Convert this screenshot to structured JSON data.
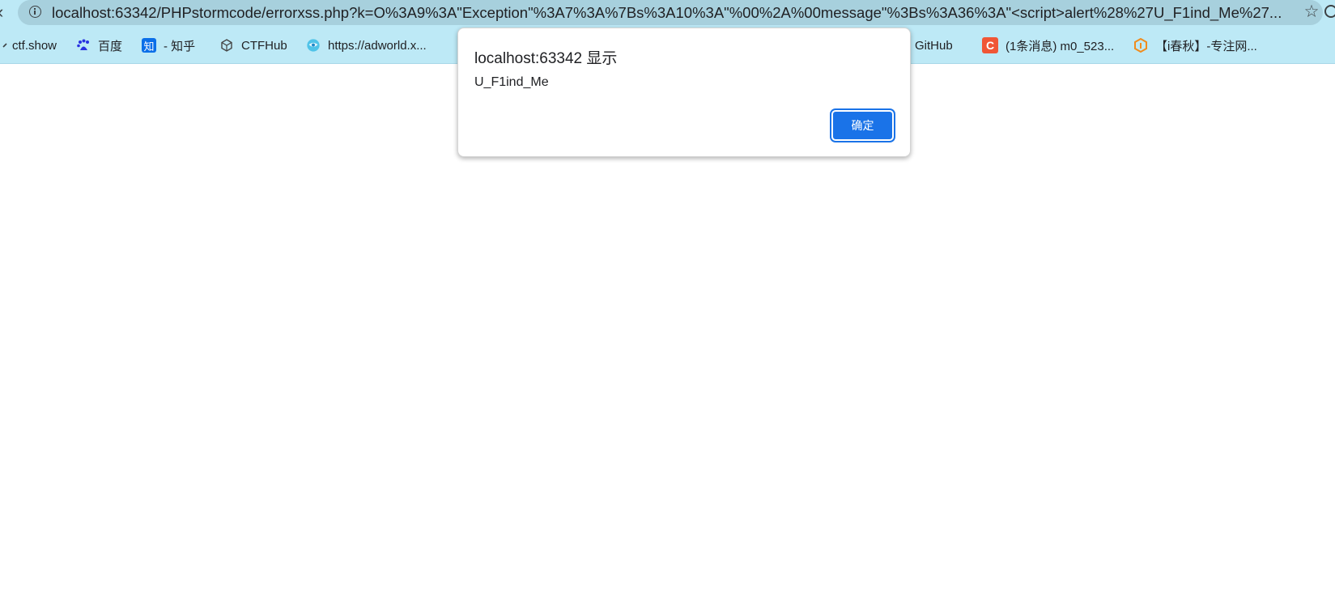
{
  "browser": {
    "url": "localhost:63342/PHPstormcode/errorxss.php?k=O%3A9%3A\"Exception\"%3A7%3A%7Bs%3A10%3A\"%00%2A%00message\"%3Bs%3A36%3A\"<script>alert%28%27U_F1ind_Me%27..."
  },
  "bookmarks": [
    {
      "label": "ctf.show",
      "icon": "arrow-icon"
    },
    {
      "label": "百度",
      "icon": "baidu-paw-icon"
    },
    {
      "label": "- 知乎",
      "icon": "zhihu-icon",
      "badge": "知"
    },
    {
      "label": "CTFHub",
      "icon": "ctfhub-cube-icon"
    },
    {
      "label": "https://adworld.x...",
      "icon": "adworld-globe-icon"
    },
    {
      "label": "GitHub",
      "icon": "github-icon"
    },
    {
      "label": "(1条消息) m0_523...",
      "icon": "csdn-icon",
      "badge": "C"
    },
    {
      "label": "【i春秋】-专注网...",
      "icon": "ichunqiu-icon"
    }
  ],
  "dialog": {
    "title": "localhost:63342 显示",
    "message": "U_F1ind_Me",
    "ok_label": "确定"
  },
  "colors": {
    "toolbar": "#bde9f6",
    "omnibox": "#a7d0dd",
    "primary": "#1a73e8"
  }
}
